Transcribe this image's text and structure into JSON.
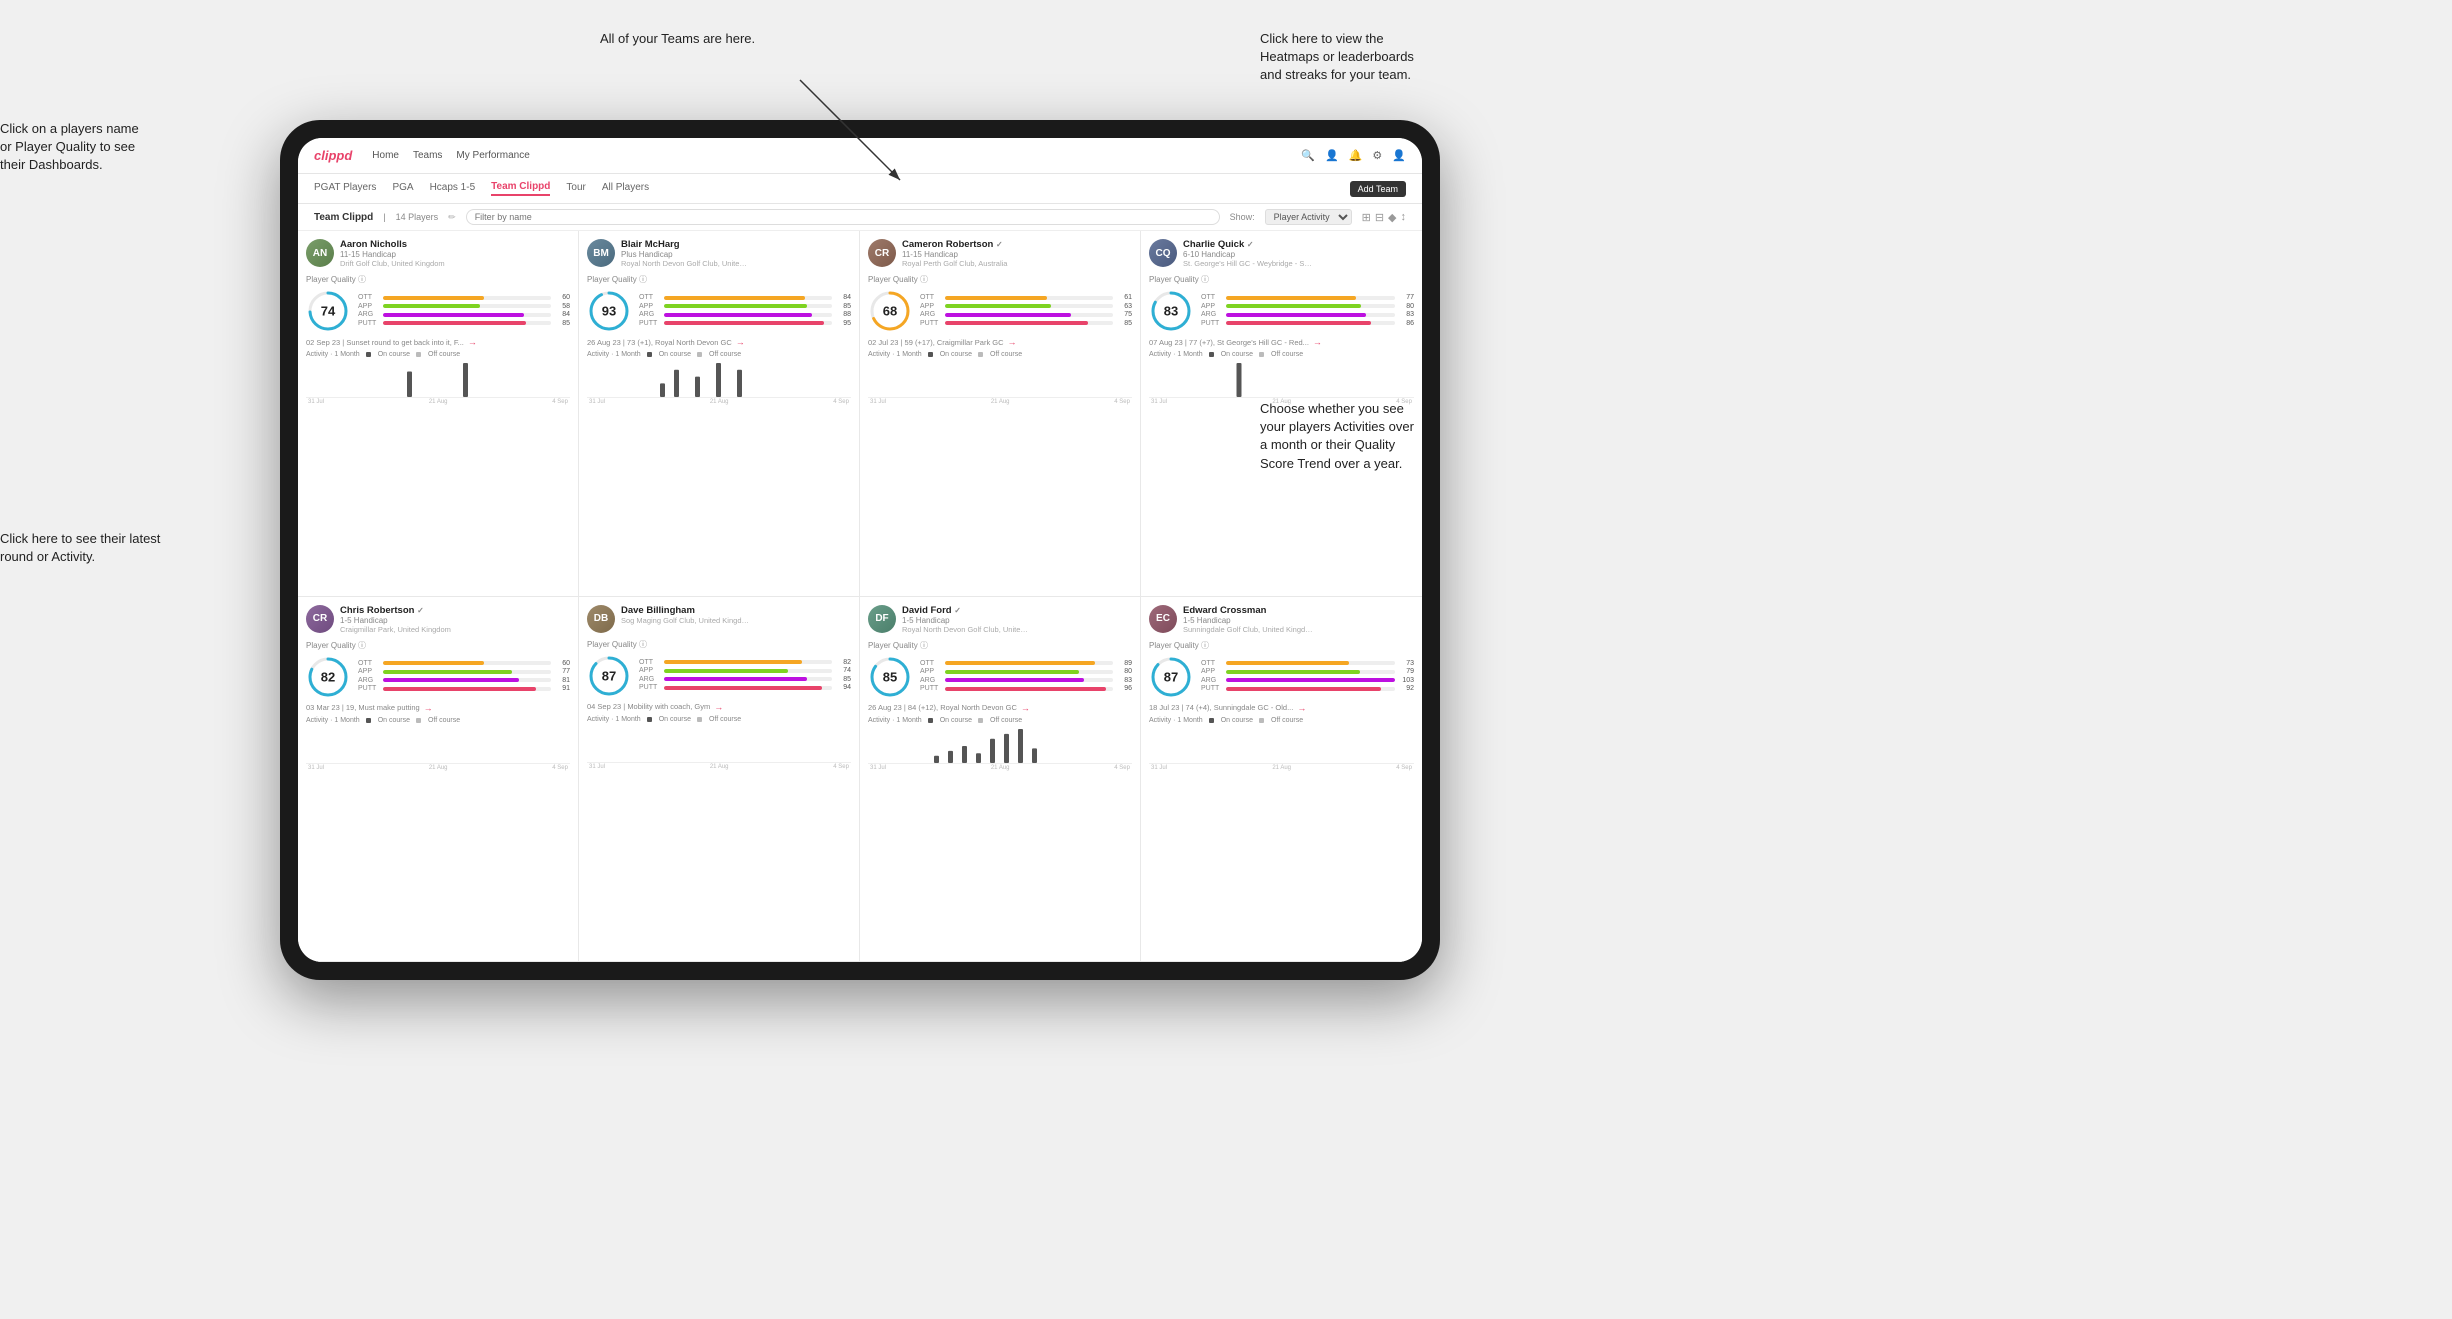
{
  "annotations": {
    "teams_tooltip": "All of your Teams are here.",
    "heatmaps_tooltip": "Click here to view the\nHeatmaps or leaderboards\nand streaks for your team.",
    "player_name_tooltip": "Click on a players name\nor Player Quality to see\ntheir Dashboards.",
    "latest_round_tooltip": "Click here to see their latest\nround or Activity.",
    "activity_tooltip": "Choose whether you see\nyour players Activities over\na month or their Quality\nScore Trend over a year."
  },
  "nav": {
    "brand": "clippd",
    "items": [
      "Home",
      "Teams",
      "My Performance"
    ],
    "icons": [
      "🔍",
      "👤",
      "🔔",
      "⚙",
      "👤"
    ]
  },
  "sub_nav": {
    "items": [
      "PGAT Players",
      "PGA",
      "Hcaps 1-5",
      "Team Clippd",
      "Tour",
      "All Players"
    ],
    "active": "Team Clippd",
    "add_team_label": "Add Team"
  },
  "team_header": {
    "title": "Team Clippd",
    "separator": "|",
    "count": "14 Players",
    "search_placeholder": "Filter by name",
    "show_label": "Show:",
    "show_option": "Player Activity",
    "view_icons": [
      "⊞",
      "⊟",
      "♦",
      "↕"
    ]
  },
  "players": [
    {
      "id": "aaron-nicholls",
      "name": "Aaron Nicholls",
      "handicap": "11-15 Handicap",
      "club": "Drift Golf Club, United Kingdom",
      "quality": 74,
      "quality_color": "#2eafd4",
      "stats": {
        "OTT": {
          "value": 60,
          "pct": 60
        },
        "APP": {
          "value": 58,
          "pct": 58
        },
        "ARG": {
          "value": 84,
          "pct": 84
        },
        "PUTT": {
          "value": 85,
          "pct": 85
        }
      },
      "latest_round": "02 Sep 23 | Sunset round to get back into it, F...",
      "activity_bars": [
        0,
        0,
        0,
        0,
        0,
        0,
        3,
        0,
        0,
        0,
        0,
        0,
        0,
        0,
        4,
        0,
        0,
        0,
        0,
        0
      ],
      "chart_dates": [
        "31 Jul",
        "21 Aug",
        "4 Sep"
      ]
    },
    {
      "id": "blair-mcharg",
      "name": "Blair McHarg",
      "handicap": "Plus Handicap",
      "club": "Royal North Devon Golf Club, United Ki...",
      "quality": 93,
      "quality_color": "#2eafd4",
      "stats": {
        "OTT": {
          "value": 84,
          "pct": 84
        },
        "APP": {
          "value": 85,
          "pct": 85
        },
        "ARG": {
          "value": 88,
          "pct": 88
        },
        "PUTT": {
          "value": 95,
          "pct": 95
        }
      },
      "latest_round": "26 Aug 23 | 73 (+1), Royal North Devon GC",
      "activity_bars": [
        0,
        0,
        4,
        0,
        8,
        0,
        0,
        6,
        0,
        0,
        10,
        0,
        0,
        8,
        0,
        0,
        0,
        0,
        0,
        0
      ],
      "chart_dates": [
        "31 Jul",
        "21 Aug",
        "4 Sep"
      ]
    },
    {
      "id": "cameron-robertson",
      "name": "Cameron Robertson",
      "verified": true,
      "handicap": "11-15 Handicap",
      "club": "Royal Perth Golf Club, Australia",
      "quality": 68,
      "quality_color": "#f5a623",
      "stats": {
        "OTT": {
          "value": 61,
          "pct": 61
        },
        "APP": {
          "value": 63,
          "pct": 63
        },
        "ARG": {
          "value": 75,
          "pct": 75
        },
        "PUTT": {
          "value": 85,
          "pct": 85
        }
      },
      "latest_round": "02 Jul 23 | 59 (+17), Craigmillar Park GC",
      "activity_bars": [
        0,
        0,
        0,
        0,
        0,
        0,
        0,
        0,
        0,
        0,
        0,
        0,
        0,
        0,
        0,
        0,
        0,
        0,
        0,
        0
      ],
      "chart_dates": [
        "31 Jul",
        "21 Aug",
        "4 Sep"
      ]
    },
    {
      "id": "charlie-quick",
      "name": "Charlie Quick",
      "verified": true,
      "handicap": "6-10 Handicap",
      "club": "St. George's Hill GC - Weybridge - Surrey...",
      "quality": 83,
      "quality_color": "#2eafd4",
      "stats": {
        "OTT": {
          "value": 77,
          "pct": 77
        },
        "APP": {
          "value": 80,
          "pct": 80
        },
        "ARG": {
          "value": 83,
          "pct": 83
        },
        "PUTT": {
          "value": 86,
          "pct": 86
        }
      },
      "latest_round": "07 Aug 23 | 77 (+7), St George's Hill GC - Red...",
      "activity_bars": [
        0,
        0,
        0,
        0,
        5,
        0,
        0,
        0,
        0,
        0,
        0,
        0,
        0,
        0,
        0,
        0,
        0,
        0,
        0,
        0
      ],
      "chart_dates": [
        "31 Jul",
        "21 Aug",
        "4 Sep"
      ]
    },
    {
      "id": "chris-robertson",
      "name": "Chris Robertson",
      "verified": true,
      "handicap": "1-5 Handicap",
      "club": "Craigmillar Park, United Kingdom",
      "quality": 82,
      "quality_color": "#2eafd4",
      "stats": {
        "OTT": {
          "value": 60,
          "pct": 60
        },
        "APP": {
          "value": 77,
          "pct": 77
        },
        "ARG": {
          "value": 81,
          "pct": 81
        },
        "PUTT": {
          "value": 91,
          "pct": 91
        }
      },
      "latest_round": "03 Mar 23 | 19, Must make putting",
      "activity_bars": [
        0,
        0,
        0,
        0,
        0,
        0,
        0,
        0,
        0,
        0,
        0,
        0,
        0,
        0,
        0,
        0,
        0,
        0,
        0,
        0
      ],
      "chart_dates": [
        "31 Jul",
        "21 Aug",
        "4 Sep"
      ]
    },
    {
      "id": "dave-billingham",
      "name": "Dave Billingham",
      "handicap": "",
      "club": "Sog Maging Golf Club, United Kingdom",
      "quality": 87,
      "quality_color": "#2eafd4",
      "stats": {
        "OTT": {
          "value": 82,
          "pct": 82
        },
        "APP": {
          "value": 74,
          "pct": 74
        },
        "ARG": {
          "value": 85,
          "pct": 85
        },
        "PUTT": {
          "value": 94,
          "pct": 94
        }
      },
      "latest_round": "04 Sep 23 | Mobility with coach, Gym",
      "activity_bars": [
        0,
        0,
        0,
        0,
        0,
        0,
        0,
        0,
        0,
        0,
        0,
        0,
        0,
        0,
        0,
        0,
        0,
        0,
        0,
        0
      ],
      "chart_dates": [
        "31 Jul",
        "21 Aug",
        "4 Sep"
      ]
    },
    {
      "id": "david-ford",
      "name": "David Ford",
      "verified": true,
      "handicap": "1-5 Handicap",
      "club": "Royal North Devon Golf Club, United Kin...",
      "quality": 85,
      "quality_color": "#2eafd4",
      "stats": {
        "OTT": {
          "value": 89,
          "pct": 89
        },
        "APP": {
          "value": 80,
          "pct": 80
        },
        "ARG": {
          "value": 83,
          "pct": 83
        },
        "PUTT": {
          "value": 96,
          "pct": 96
        }
      },
      "latest_round": "26 Aug 23 | 84 (+12), Royal North Devon GC",
      "activity_bars": [
        0,
        3,
        0,
        5,
        0,
        7,
        0,
        4,
        0,
        10,
        0,
        12,
        0,
        14,
        0,
        6,
        0,
        0,
        0,
        0
      ],
      "chart_dates": [
        "31 Jul",
        "21 Aug",
        "4 Sep"
      ]
    },
    {
      "id": "edward-crossman",
      "name": "Edward Crossman",
      "handicap": "1-5 Handicap",
      "club": "Sunningdale Golf Club, United Kingdom",
      "quality": 87,
      "quality_color": "#2eafd4",
      "stats": {
        "OTT": {
          "value": 73,
          "pct": 73
        },
        "APP": {
          "value": 79,
          "pct": 79
        },
        "ARG": {
          "value": 103,
          "pct": 100
        },
        "PUTT": {
          "value": 92,
          "pct": 92
        }
      },
      "latest_round": "18 Jul 23 | 74 (+4), Sunningdale GC - Old...",
      "activity_bars": [
        0,
        0,
        0,
        0,
        0,
        0,
        0,
        0,
        0,
        0,
        0,
        0,
        0,
        0,
        0,
        0,
        0,
        0,
        0,
        0
      ],
      "chart_dates": [
        "31 Jul",
        "21 Aug",
        "4 Sep"
      ]
    }
  ]
}
